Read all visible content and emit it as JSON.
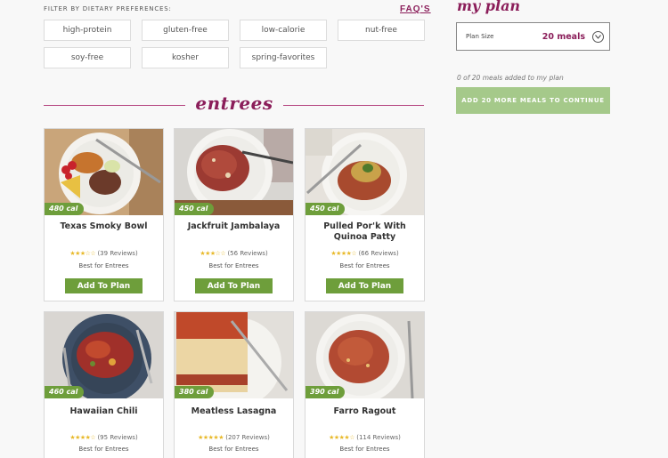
{
  "filters": {
    "heading": "FILTER BY DIETARY PREFERENCES:",
    "faq_label": "FAQ'S",
    "chips": [
      "high-protein",
      "gluten-free",
      "low-calorie",
      "nut-free",
      "soy-free",
      "kosher",
      "spring-favorites"
    ]
  },
  "section": {
    "title": "entrees"
  },
  "meals": [
    {
      "name": "Texas Smoky Bowl",
      "calories": "480 cal",
      "rating": 3.5,
      "stars": "★★★☆☆",
      "reviews": "(39 Reviews)",
      "best_for": "Best for Entrees",
      "button": "Add To Plan"
    },
    {
      "name": "Jackfruit Jambalaya",
      "calories": "450 cal",
      "rating": 3.5,
      "stars": "★★★☆☆",
      "reviews": "(56 Reviews)",
      "best_for": "Best for Entrees",
      "button": "Add To Plan"
    },
    {
      "name": "Pulled Por'k With Quinoa Patty",
      "calories": "450 cal",
      "rating": 4,
      "stars": "★★★★☆",
      "reviews": "(66 Reviews)",
      "best_for": "Best for Entrees",
      "button": "Add To Plan"
    },
    {
      "name": "Hawaiian Chili",
      "calories": "460 cal",
      "rating": 4,
      "stars": "★★★★☆",
      "reviews": "(95 Reviews)",
      "best_for": "Best for Entrees"
    },
    {
      "name": "Meatless Lasagna",
      "calories": "380 cal",
      "rating": 4.5,
      "stars": "★★★★★",
      "reviews": "(207 Reviews)",
      "best_for": "Best for Entrees"
    },
    {
      "name": "Farro Ragout",
      "calories": "390 cal",
      "rating": 4,
      "stars": "★★★★☆",
      "reviews": "(114 Reviews)",
      "best_for": "Best for Entrees"
    }
  ],
  "plan": {
    "title": "my plan",
    "size_label": "Plan Size",
    "size_value": "20 meals",
    "count_text": "0 of 20 meals added to my plan",
    "continue_label": "ADD 20 MORE MEALS TO CONTINUE"
  },
  "colors": {
    "accent": "#8b1e5a",
    "green": "#6e9e3b",
    "light_green": "#a5c98a",
    "star": "#e8b92a"
  }
}
